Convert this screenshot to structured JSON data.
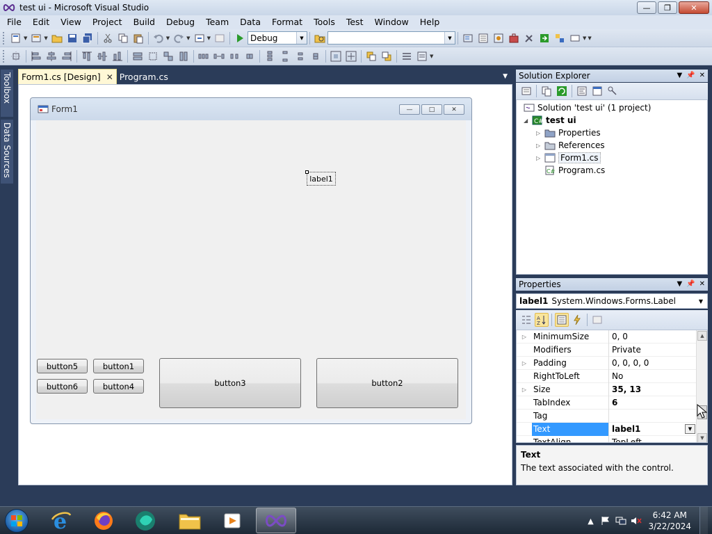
{
  "window": {
    "title": "test ui - Microsoft Visual Studio"
  },
  "menu": [
    "File",
    "Edit",
    "View",
    "Project",
    "Build",
    "Debug",
    "Team",
    "Data",
    "Format",
    "Tools",
    "Test",
    "Window",
    "Help"
  ],
  "toolbar": {
    "config_value": "Debug",
    "platform_value": ""
  },
  "side_tabs": {
    "toolbox": "Toolbox",
    "data_sources": "Data Sources"
  },
  "doc_tabs": [
    {
      "label": "Form1.cs [Design]",
      "active": true
    },
    {
      "label": "Program.cs",
      "active": false
    }
  ],
  "designer": {
    "form_title": "Form1",
    "label1": "label1",
    "buttons": {
      "button1": "button1",
      "button2": "button2",
      "button3": "button3",
      "button4": "button4",
      "button5": "button5",
      "button6": "button6"
    }
  },
  "solution_explorer": {
    "title": "Solution Explorer",
    "tree": {
      "solution": "Solution 'test ui' (1 project)",
      "project": "test ui",
      "properties": "Properties",
      "references": "References",
      "form1": "Form1.cs",
      "program": "Program.cs"
    }
  },
  "properties": {
    "title": "Properties",
    "object_name": "label1",
    "object_type": "System.Windows.Forms.Label",
    "rows": [
      {
        "name": "MinimumSize",
        "value": "0, 0",
        "expandable": true
      },
      {
        "name": "Modifiers",
        "value": "Private",
        "expandable": false
      },
      {
        "name": "Padding",
        "value": "0, 0, 0, 0",
        "expandable": true
      },
      {
        "name": "RightToLeft",
        "value": "No",
        "expandable": false
      },
      {
        "name": "Size",
        "value": "35, 13",
        "expandable": true,
        "bold": true
      },
      {
        "name": "TabIndex",
        "value": "6",
        "expandable": false,
        "bold": true
      },
      {
        "name": "Tag",
        "value": "",
        "expandable": false
      },
      {
        "name": "Text",
        "value": "label1",
        "expandable": false,
        "bold": true,
        "selected": true
      },
      {
        "name": "TextAlign",
        "value": "TopLeft",
        "expandable": false
      }
    ],
    "description_title": "Text",
    "description_text": "The text associated with the control."
  },
  "taskbar": {
    "time": "6:42 AM",
    "date": "3/22/2024"
  },
  "colors": {
    "ide_background": "#2b3c59",
    "selection": "#3399ff",
    "active_tab": "#fff8d6"
  }
}
